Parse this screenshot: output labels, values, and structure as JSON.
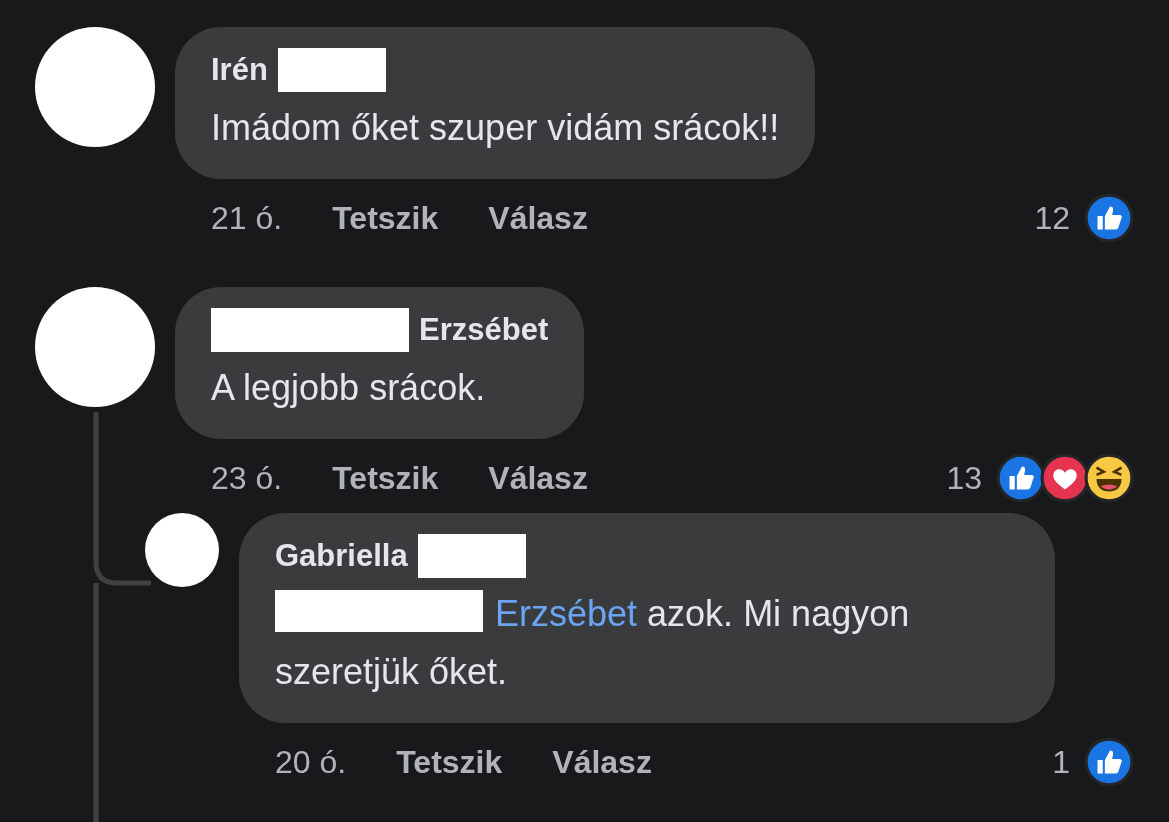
{
  "comments": [
    {
      "name_parts": [
        {
          "kind": "name",
          "text": "Irén"
        },
        {
          "kind": "redaction"
        }
      ],
      "body": [
        {
          "kind": "text",
          "text": "Imádom őket szuper vidám srácok!!"
        }
      ],
      "time": "21 ó.",
      "like_label": "Tetszik",
      "reply_label": "Válasz",
      "count": "12",
      "reactions": [
        {
          "kind": "like"
        }
      ]
    },
    {
      "name_parts": [
        {
          "kind": "redaction"
        },
        {
          "kind": "name",
          "text": "Erzsébet"
        }
      ],
      "body": [
        {
          "kind": "text",
          "text": "A legjobb srácok."
        }
      ],
      "time": "23 ó.",
      "like_label": "Tetszik",
      "reply_label": "Válasz",
      "count": "13",
      "reactions": [
        {
          "kind": "like"
        },
        {
          "kind": "love"
        },
        {
          "kind": "haha"
        }
      ],
      "replies": [
        {
          "name_parts": [
            {
              "kind": "name",
              "text": "Gabriella"
            },
            {
              "kind": "redaction"
            }
          ],
          "body": [
            {
              "kind": "redaction"
            },
            {
              "kind": "mention",
              "text": "Erzsébet"
            },
            {
              "kind": "text",
              "text": " azok. Mi nagyon szeretjük őket."
            }
          ],
          "time": "20 ó.",
          "like_label": "Tetszik",
          "reply_label": "Válasz",
          "count": "1",
          "reactions": [
            {
              "kind": "like"
            }
          ]
        }
      ]
    }
  ]
}
